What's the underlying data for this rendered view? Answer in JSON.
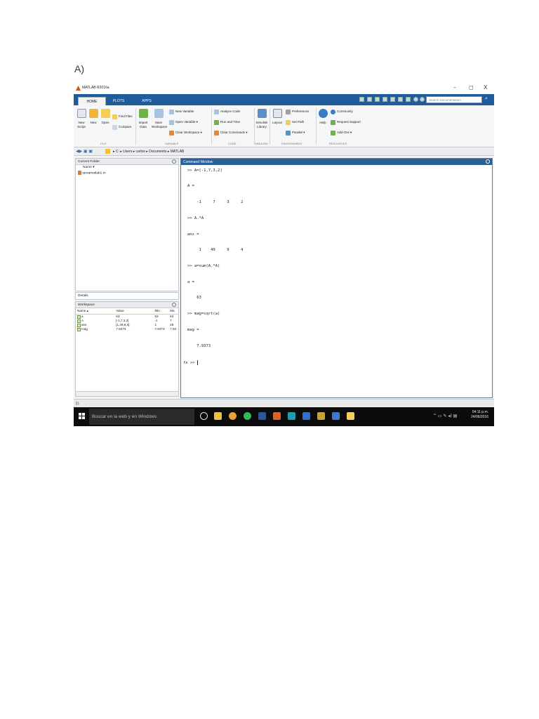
{
  "doc_label": "A)",
  "window": {
    "title": "MATLAB R2016a",
    "min": "–",
    "max": "◻",
    "close": "X"
  },
  "tabs": [
    "HOME",
    "PLOTS",
    "APPS"
  ],
  "search_placeholder": "Search Documentation",
  "toolstrip": {
    "new_script": "New Script",
    "new": "New",
    "open": "Open",
    "find_files": "Find Files",
    "compare": "Compare",
    "import_data": "Import Data",
    "save_workspace": "Save Workspace",
    "new_variable": "New Variable",
    "open_variable": "Open Variable ▾",
    "clear_workspace": "Clear Workspace ▾",
    "analyze_code": "Analyze Code",
    "run_and_time": "Run and Time",
    "clear_commands": "Clear Commands ▾",
    "simulink_library": "Simulink Library",
    "layout": "Layout",
    "preferences": "Preferences",
    "set_path": "Set Path",
    "parallel": "Parallel ▾",
    "help": "Help",
    "community": "Community",
    "request_support": "Request Support",
    "add_ons": "Add-Ons ▾",
    "groups": {
      "file": "FILE",
      "variable": "VARIABLE",
      "code": "CODE",
      "simulink": "SIMULINK",
      "environment": "ENVIRONMENT",
      "resources": "RESOURCES"
    }
  },
  "address": {
    "path": "▸ C: ▸ Users ▸ carlos ▸ Documents ▸ MATLAB"
  },
  "current_folder": {
    "title": "Current Folder",
    "column": "Name ▾",
    "files": [
      "tareamatlab1.m"
    ]
  },
  "details_title": "Details",
  "workspace": {
    "title": "Workspace",
    "columns": [
      "Name ▴",
      "Value",
      "Min",
      "Ma"
    ],
    "rows": [
      {
        "name": "a",
        "value": "63",
        "min": "63",
        "max": "63"
      },
      {
        "name": "A",
        "value": "[-1,7,3,2]",
        "min": "-1",
        "max": "7"
      },
      {
        "name": "ans",
        "value": "[1,49,9,4]",
        "min": "1",
        "max": "49"
      },
      {
        "name": "mag",
        "value": "7.9373",
        "min": "7.9373",
        "max": "7.93"
      }
    ]
  },
  "command_window": {
    "title": "Command Window",
    "lines": [
      ">> A=[-1,7,3,2]",
      "A =",
      "    -1     7     3     2",
      ">> A.*A",
      "ans =",
      "     1    49     9     4",
      ">> a=sum(A.*A)",
      "a =",
      "    63",
      ">> mag=sqrt(a)",
      "mag =",
      "    7.9373"
    ],
    "prompt_fx": "fx",
    "prompt": ">>"
  },
  "statusbar_text": "|||.",
  "taskbar": {
    "search": "Buscar en la web y en Windows",
    "time": "04:11 p.m.",
    "date": "24/06/2016"
  },
  "colors": {
    "ribbon_blue": "#1f5c99",
    "command_header": "#2c5f95",
    "taskbar": "#0c0c0c"
  }
}
